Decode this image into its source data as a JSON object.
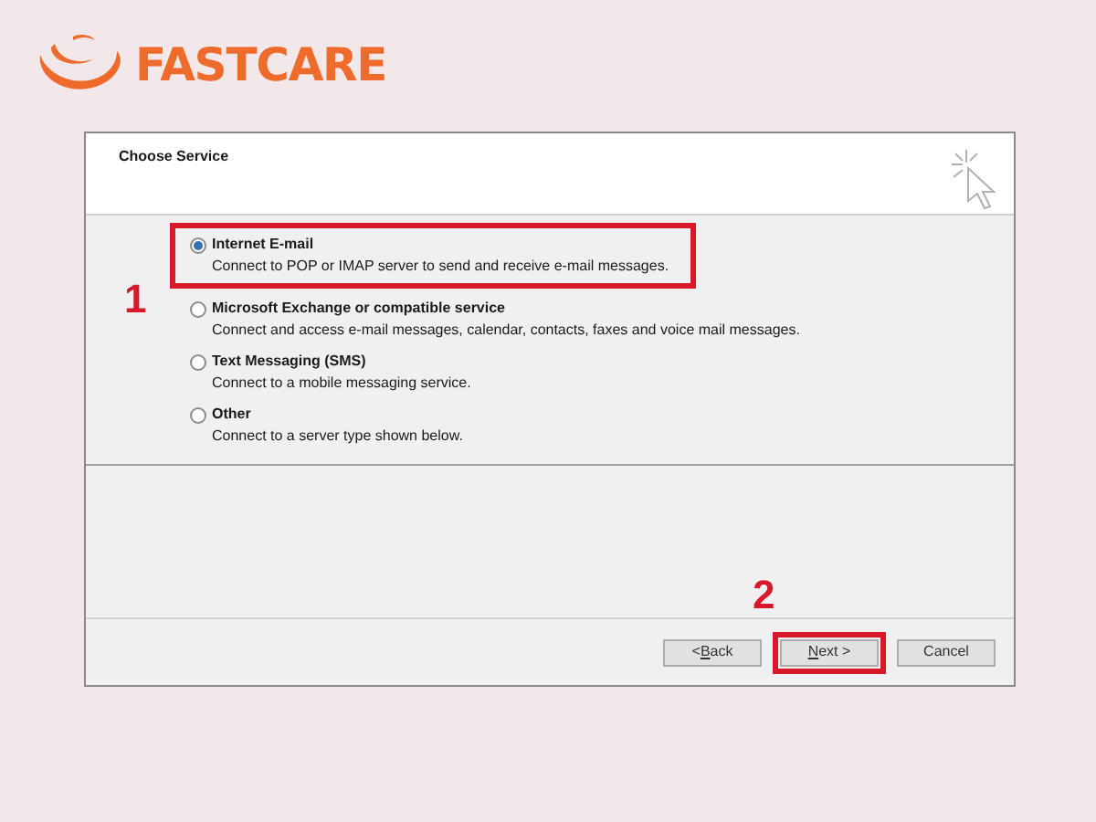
{
  "brand": {
    "name": "FASTCARE"
  },
  "dialog": {
    "title": "Choose Service",
    "options": [
      {
        "label": "Internet E-mail",
        "description": "Connect to POP or IMAP server to send and receive e-mail messages.",
        "selected": true,
        "highlighted": true,
        "step": "1"
      },
      {
        "label": "Microsoft Exchange or compatible service",
        "description": "Connect and access e-mail messages, calendar, contacts, faxes and voice mail messages.",
        "selected": false,
        "highlighted": false
      },
      {
        "label": "Text Messaging (SMS)",
        "description": "Connect to a mobile messaging service.",
        "selected": false,
        "highlighted": false
      },
      {
        "label": "Other",
        "description": "Connect to a server type shown below.",
        "selected": false,
        "highlighted": false
      }
    ],
    "buttons": [
      {
        "before": "< ",
        "accelerator": "B",
        "after": "ack",
        "highlighted": false
      },
      {
        "accelerator": "N",
        "after": "ext >",
        "highlighted": true,
        "step": "2"
      },
      {
        "after": "Cancel",
        "highlighted": false
      }
    ]
  }
}
